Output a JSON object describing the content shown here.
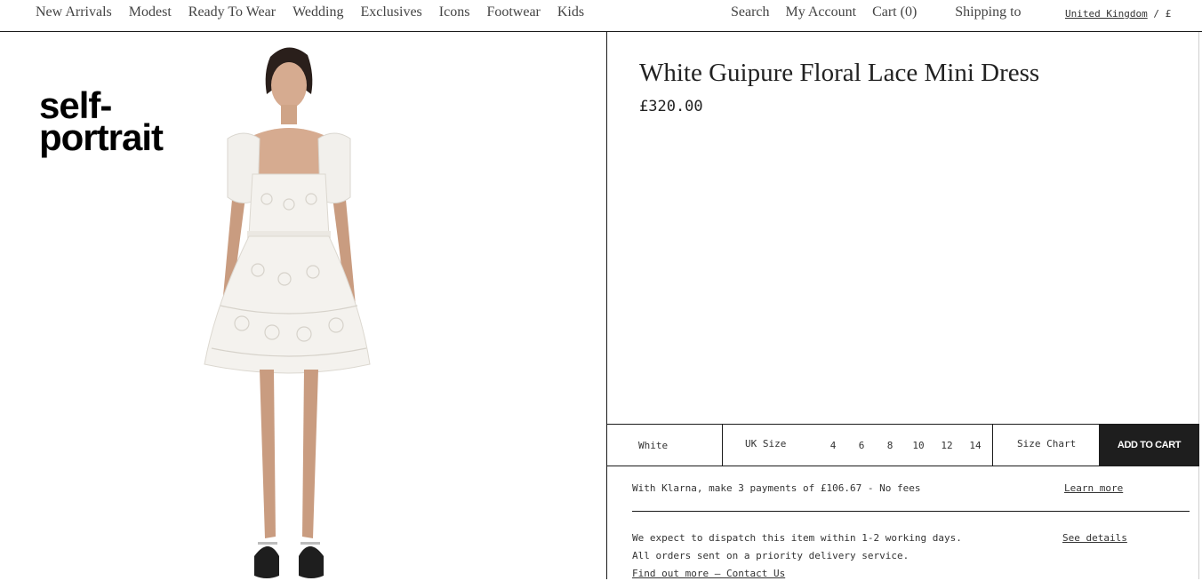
{
  "nav": {
    "left": [
      "New Arrivals",
      "Modest",
      "Ready To Wear",
      "Wedding",
      "Exclusives",
      "Icons",
      "Footwear",
      "Kids"
    ],
    "search": "Search",
    "account": "My Account",
    "cart": "Cart (0)",
    "shipping": "Shipping to",
    "country": "United Kingdom",
    "separator": "/",
    "currency": "£"
  },
  "brand": {
    "logo_line1": "self-",
    "logo_line2": "portrait"
  },
  "product": {
    "title": "White Guipure Floral Lace Mini Dress",
    "price": "£320.00",
    "color": "White",
    "size_label": "UK Size",
    "sizes": [
      "4",
      "6",
      "8",
      "10",
      "12",
      "14"
    ],
    "size_chart": "Size Chart",
    "add_to_cart": "ADD TO CART"
  },
  "klarna": {
    "text": "With Klarna, make 3 payments of £106.67 - No fees",
    "link": "Learn more"
  },
  "dispatch": {
    "line1": "We expect to dispatch this item within 1-2 working days.",
    "line2": "All orders sent on a priority delivery service.",
    "link": "Find out more — Contact Us",
    "details": "See details"
  },
  "colors": {
    "text": "#1a1a1a",
    "button_bg": "#1e1e1e",
    "button_text": "#ffffff",
    "background": "#ffffff"
  }
}
